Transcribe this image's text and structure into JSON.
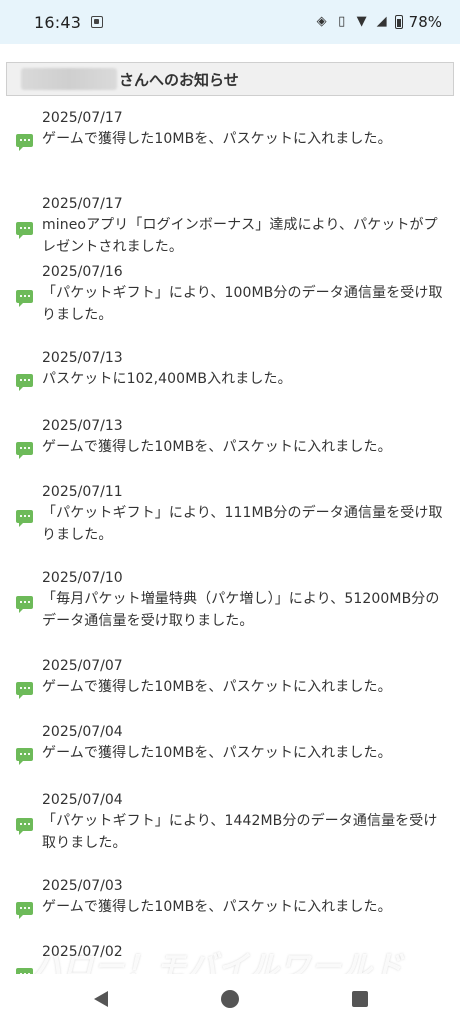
{
  "status_bar": {
    "time": "16:43",
    "battery_percent": "78%",
    "icons": [
      "nfc-icon",
      "vibrate-icon",
      "wifi-icon",
      "signal-icon",
      "battery-icon"
    ]
  },
  "header": {
    "title": "さんへのお知らせ"
  },
  "notices": [
    {
      "date": "2025/07/17",
      "lines": [
        "ゲームで獲得した10MBを、パスケットに入れました。"
      ]
    },
    {
      "date": "2025/07/17",
      "lines": [
        "mineoアプリ「ログインボーナス」達成により、パケットがプ",
        "レゼントされました。"
      ]
    },
    {
      "date": "2025/07/16",
      "lines": [
        "「パケットギフト」により、100MB分のデータ通信量を受け取",
        "りました。"
      ]
    },
    {
      "date": "2025/07/13",
      "lines": [
        "パスケットに102,400MB入れました。"
      ]
    },
    {
      "date": "2025/07/13",
      "lines": [
        "ゲームで獲得した10MBを、パスケットに入れました。"
      ]
    },
    {
      "date": "2025/07/11",
      "lines": [
        "「パケットギフト」により、111MB分のデータ通信量を受け取",
        "りました。"
      ]
    },
    {
      "date": "2025/07/10",
      "lines": [
        "「毎月パケット増量特典（パケ増し）」により、51200MB分の",
        "データ通信量を受け取りました。"
      ]
    },
    {
      "date": "2025/07/07",
      "lines": [
        "ゲームで獲得した10MBを、パスケットに入れました。"
      ]
    },
    {
      "date": "2025/07/04",
      "lines": [
        "ゲームで獲得した10MBを、パスケットに入れました。"
      ]
    },
    {
      "date": "2025/07/04",
      "lines": [
        "「パケットギフト」により、1442MB分のデータ通信量を受け",
        "取りました。"
      ]
    },
    {
      "date": "2025/07/03",
      "lines": [
        "ゲームで獲得した10MBを、パスケットに入れました。"
      ]
    },
    {
      "date": "2025/07/02",
      "lines": [
        ""
      ]
    }
  ],
  "watermark": "ハロー！モバイルワールド",
  "colors": {
    "status_bar_bg": "#e7f4fb",
    "header_bg": "#f0f0f0",
    "icon_green": "#6dba59",
    "text": "#333333"
  }
}
